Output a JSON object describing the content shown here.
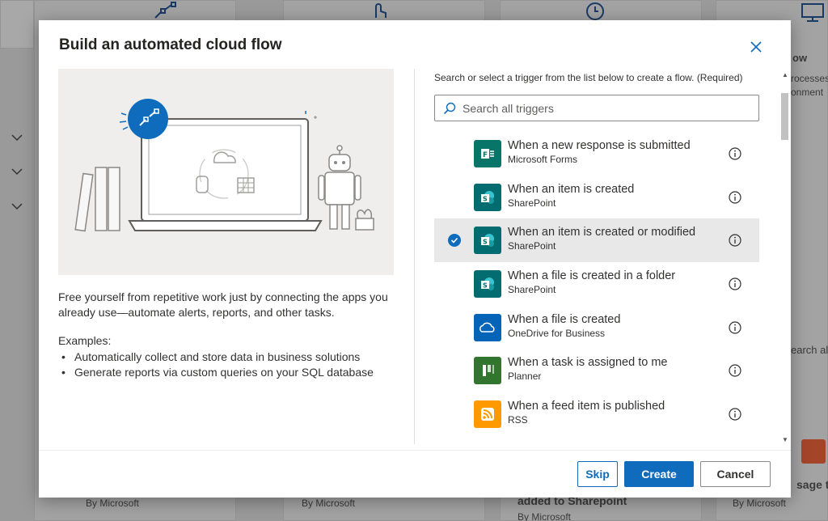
{
  "background": {
    "right_header_fragment": "ow",
    "right_text_1": "rocesses",
    "right_text_2": "onment",
    "right_search_fragment": "earch al",
    "bottom_by_1": "By Microsoft",
    "bottom_by_2": "By Microsoft",
    "bottom_added": "added to Sharepoint",
    "bottom_by_3": "By Microsoft",
    "bottom_by_4": "By Microsoft",
    "bottom_msg": "sage to"
  },
  "modal": {
    "title": "Build an automated cloud flow",
    "description": "Free yourself from repetitive work just by connecting the apps you already use—automate alerts, reports, and other tasks.",
    "examples_title": "Examples:",
    "examples": [
      "Automatically collect and store data in business solutions",
      "Generate reports via custom queries on your SQL database"
    ],
    "trigger_hint": "Search or select a trigger from the list below to create a flow. (Required)",
    "search_placeholder": "Search all triggers",
    "triggers": [
      {
        "title": "When a new response is submitted",
        "app": "Microsoft Forms",
        "color": "#077568",
        "selected": false,
        "icon": "forms-icon"
      },
      {
        "title": "When an item is created",
        "app": "SharePoint",
        "color": "#036c70",
        "selected": false,
        "icon": "sharepoint-icon"
      },
      {
        "title": "When an item is created or modified",
        "app": "SharePoint",
        "color": "#036c70",
        "selected": true,
        "icon": "sharepoint-icon"
      },
      {
        "title": "When a file is created in a folder",
        "app": "SharePoint",
        "color": "#036c70",
        "selected": false,
        "icon": "sharepoint-icon"
      },
      {
        "title": "When a file is created",
        "app": "OneDrive for Business",
        "color": "#0364b8",
        "selected": false,
        "icon": "onedrive-icon"
      },
      {
        "title": "When a task is assigned to me",
        "app": "Planner",
        "color": "#31752f",
        "selected": false,
        "icon": "planner-icon"
      },
      {
        "title": "When a feed item is published",
        "app": "RSS",
        "color": "#ff9900",
        "selected": false,
        "icon": "rss-icon"
      }
    ],
    "buttons": {
      "skip": "Skip",
      "create": "Create",
      "cancel": "Cancel"
    }
  },
  "colors": {
    "accent": "#0f6cbd",
    "selected_row": "#e8e8e8"
  }
}
